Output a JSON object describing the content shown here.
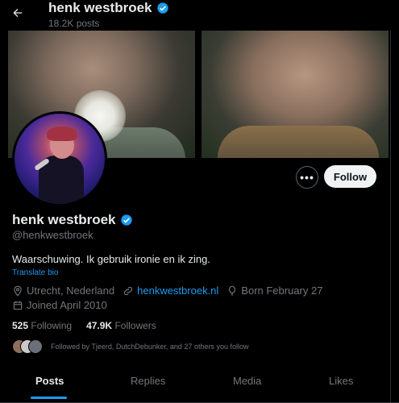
{
  "header": {
    "name": "henk westbroek",
    "posts_count": "18.2K posts"
  },
  "profile": {
    "display_name": "henk westbroek",
    "handle": "@henkwestbroek",
    "bio": "Waarschuwing. Ik gebruik ironie en ik zing.",
    "translate_label": "Translate bio",
    "location": "Utrecht, Nederland",
    "website": "henkwestbroek.nl",
    "birthday": "Born February 27",
    "joined": "Joined April 2010"
  },
  "actions": {
    "more_label": "•••",
    "follow_label": "Follow"
  },
  "stats": {
    "following_count": "525",
    "following_label": "Following",
    "followers_count": "47.9K",
    "followers_label": "Followers"
  },
  "followed_by": "Followed by Tjeerd, DutchDebunker, and 27 others you follow",
  "tabs": [
    "Posts",
    "Replies",
    "Media",
    "Likes"
  ],
  "colors": {
    "accent": "#1d9bf0",
    "verified": "#1d9bf0",
    "background": "#000000",
    "secondary_text": "#71767b"
  }
}
